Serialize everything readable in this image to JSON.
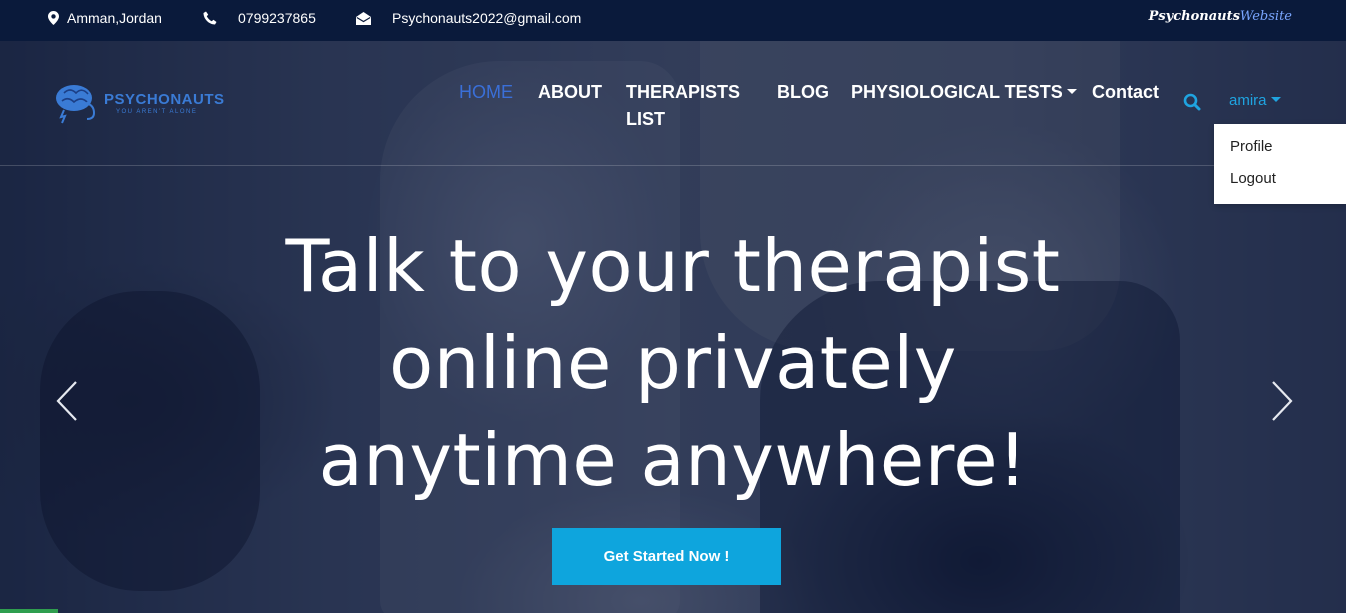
{
  "topbar": {
    "location": "Amman,Jordan",
    "phone": "0799237865",
    "email": "Psychonauts2022@gmail.com",
    "brand_part1": "Psychonauts",
    "brand_part2": "Website",
    "icons": [
      "location-pin-icon",
      "phone-icon",
      "envelope-icon"
    ]
  },
  "logo": {
    "name": "PSYCHONAUTS",
    "tagline": "YOU AREN'T ALONE"
  },
  "nav": {
    "home": "HOME",
    "about": "ABOUT",
    "therapists": "THERAPISTS LIST",
    "blog": "BLOG",
    "tests": "PHYSIOLOGICAL TESTS",
    "contact": "Contact",
    "user": "amira"
  },
  "user_dropdown": {
    "profile": "Profile",
    "logout": "Logout"
  },
  "hero": {
    "line1": "Talk to your therapist",
    "line2": "online privately",
    "line3": "anytime anywhere!",
    "cta": "Get Started Now !"
  },
  "colors": {
    "topbar_bg": "#0a1a3b",
    "accent_active": "#3a6fd8",
    "accent_cyan": "#0ea5dd",
    "user_link": "#1fa4e0"
  }
}
